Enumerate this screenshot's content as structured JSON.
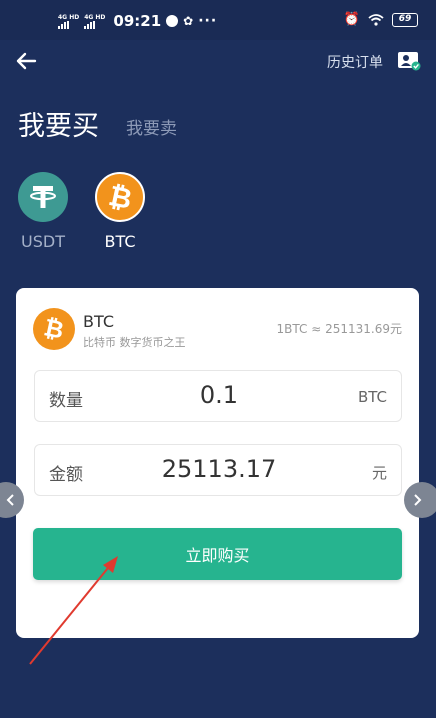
{
  "status_bar": {
    "signal1": "4G HD",
    "signal2": "4G HD",
    "time": "09:21",
    "more": "···",
    "battery": "69"
  },
  "header": {
    "history_label": "历史订单"
  },
  "tabs": {
    "buy": "我要买",
    "sell": "我要卖"
  },
  "coins": [
    {
      "label": "USDT",
      "color": "#3e9a93",
      "icon": "tether-icon"
    },
    {
      "label": "BTC",
      "color": "#f2931c",
      "icon": "bitcoin-icon",
      "selected": true
    }
  ],
  "card": {
    "coin_name": "BTC",
    "coin_desc": "比特币  数字货币之王",
    "rate": "1BTC ≈ 251131.69元",
    "quantity": {
      "label": "数量",
      "value": "0.1",
      "unit": "BTC"
    },
    "amount": {
      "label": "金额",
      "value": "25113.17",
      "unit": "元"
    },
    "buy_button": "立即购买"
  },
  "colors": {
    "background": "#1c2f5c",
    "accent": "#26b48f",
    "btc_orange": "#f2931c",
    "annotation_red": "#e03a2f"
  }
}
